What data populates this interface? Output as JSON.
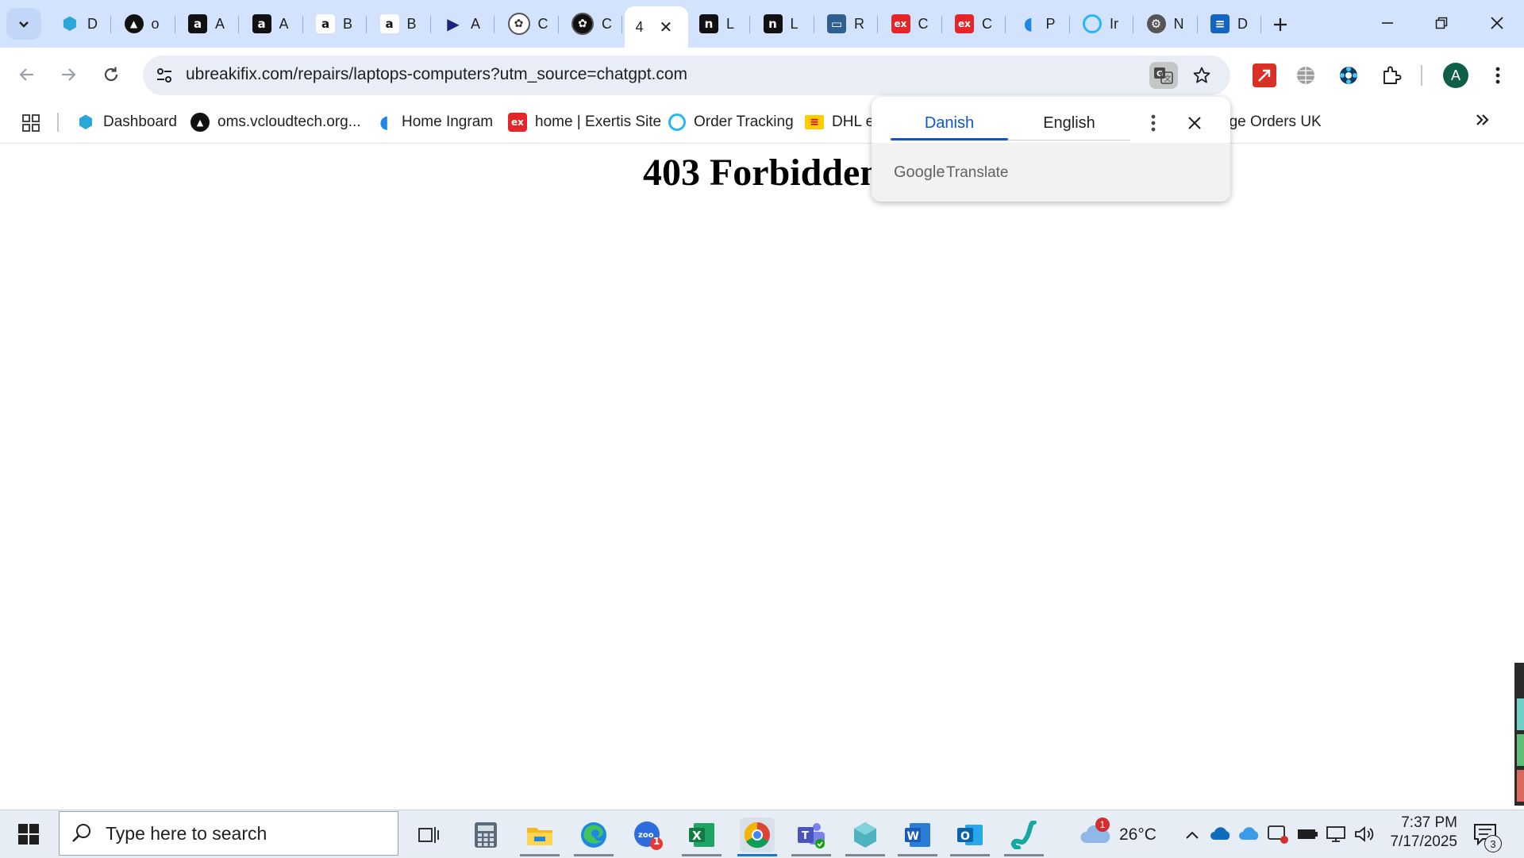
{
  "tabs": [
    {
      "title": "D",
      "icon": "hexagon-blue-icon",
      "color": "#2aa7d6"
    },
    {
      "title": "o",
      "icon": "triangle-circle-icon",
      "color": "#111111"
    },
    {
      "title": "A",
      "icon": "amazon-icon",
      "color": "#111111"
    },
    {
      "title": "A",
      "icon": "amazon-icon",
      "color": "#111111"
    },
    {
      "title": "B",
      "icon": "amazon-icon",
      "color": "#ffffff"
    },
    {
      "title": "B",
      "icon": "amazon-icon",
      "color": "#ffffff"
    },
    {
      "title": "A",
      "icon": "play-arrow-icon",
      "color": "#1a237e"
    },
    {
      "title": "C",
      "icon": "openai-icon",
      "color": "#ffffff"
    },
    {
      "title": "C",
      "icon": "openai-icon",
      "color": "#111111"
    },
    {
      "title": "4",
      "icon": "none",
      "color": "#ffffff",
      "active": true
    },
    {
      "title": "L",
      "icon": "n-logo-icon",
      "color": "#111111"
    },
    {
      "title": "L",
      "icon": "n-logo-icon",
      "color": "#111111"
    },
    {
      "title": "R",
      "icon": "card-icon",
      "color": "#2f5f8f"
    },
    {
      "title": "C",
      "icon": "exertis-icon",
      "color": "#e4262b"
    },
    {
      "title": "C",
      "icon": "exertis-icon",
      "color": "#e4262b"
    },
    {
      "title": "P",
      "icon": "ingram-icon",
      "color": "#1e88e5"
    },
    {
      "title": "Ir",
      "icon": "c-circle-icon",
      "color": "#29b6f6"
    },
    {
      "title": "N",
      "icon": "gear-icon",
      "color": "#555555"
    },
    {
      "title": "D",
      "icon": "doc-icon",
      "color": "#1565c0"
    }
  ],
  "address": {
    "url": "ubreakifix.com/repairs/laptops-computers?utm_source=chatgpt.com"
  },
  "profile": {
    "initial": "A"
  },
  "bookmarks": [
    {
      "label": "Dashboard",
      "icon": "hexagon-blue-icon",
      "color": "#2aa7d6"
    },
    {
      "label": "oms.vcloudtech.org...",
      "icon": "triangle-circle-icon",
      "color": "#111111"
    },
    {
      "label": "Home Ingram",
      "icon": "ingram-icon",
      "color": "#1e88e5"
    },
    {
      "label": "home | Exertis Site",
      "icon": "exertis-icon",
      "color": "#e4262b"
    },
    {
      "label": "Order Tracking",
      "icon": "c-circle-icon",
      "color": "#29b6f6"
    },
    {
      "label": "DHL e",
      "icon": "dhl-icon",
      "color": "#ffcc00"
    },
    {
      "label": "age Orders UK",
      "icon": "none",
      "color": "#ffffff"
    }
  ],
  "page": {
    "heading": "403 Forbidden"
  },
  "translate": {
    "lang_source": "Danish",
    "lang_target": "English",
    "brand_google": "Google",
    "brand_translate": "Translate"
  },
  "taskbar": {
    "search_placeholder": "Type here to search",
    "weather": "26°C",
    "weather_badge": "1",
    "time": "7:37 PM",
    "date": "7/17/2025",
    "zoom_badge": "1",
    "notif_count": "3"
  },
  "colors": {
    "accent": "#0b57d0",
    "tabstrip": "#d3e3fd",
    "omnibox": "#e9eef6"
  }
}
